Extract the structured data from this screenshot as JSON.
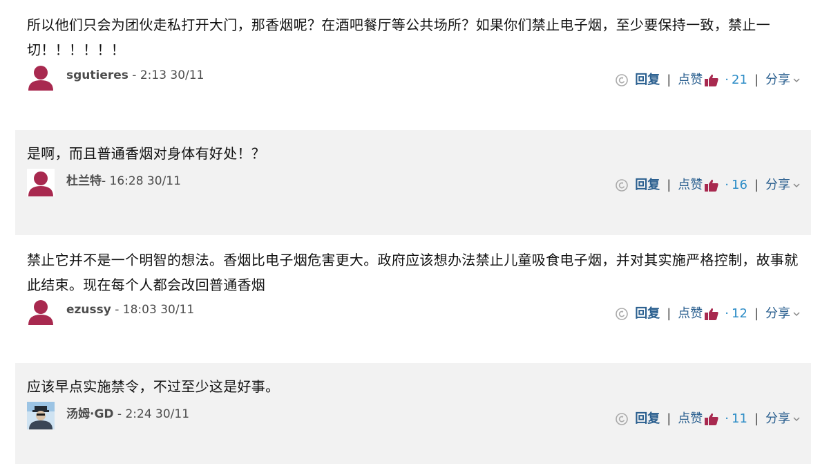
{
  "comments": [
    {
      "text": "所以他们只会为团伙走私打开大门，那香烟呢？在酒吧餐厅等公共场所？如果你们禁止电子烟，至少要保持一致，禁止一切！！！！！！",
      "author": "sgutieres",
      "time": " - 2:13 30/11",
      "avatar": "user-silhouette",
      "likes": "21"
    },
    {
      "text": "是啊，而且普通香烟对身体有好处！？",
      "author": "杜兰特",
      "time": "- 16:28 30/11",
      "avatar": "user-silhouette",
      "likes": "16"
    },
    {
      "text": "禁止它并不是一个明智的想法。香烟比电子烟危害更大。政府应该想办法禁止儿童吸食电子烟，并对其实施严格控制，故事就此结束。现在每个人都会改回普通香烟",
      "author": "ezussy",
      "time": " - 18:03 30/11",
      "avatar": "user-silhouette",
      "likes": "12"
    },
    {
      "text": "应该早点实施禁令，不过至少这是好事。",
      "author": "汤姆·GD",
      "time": " - 2:24 30/11",
      "avatar": "user-photo",
      "likes": "11"
    }
  ],
  "actions": {
    "reply_label": "回复",
    "separator": "|",
    "like_label": "点赞",
    "like_prefix": "·",
    "share_label": "分享"
  },
  "colors": {
    "link": "#2a5f8f",
    "count": "#2a8bc6",
    "thumb": "#a8294f",
    "avatar": "#a8294f",
    "alt_background": "#f2f2f2"
  }
}
